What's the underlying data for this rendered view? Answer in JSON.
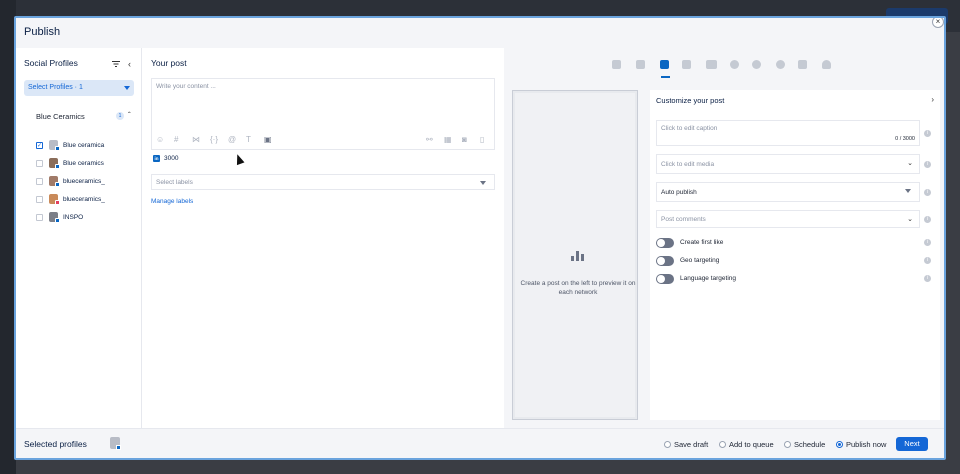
{
  "modal": {
    "title": "Publish",
    "close_glyph": "×"
  },
  "left": {
    "title": "Social Profiles",
    "select_label": "Select Profiles · 1",
    "group": {
      "name": "Blue Ceramics",
      "count": "1"
    },
    "profiles": [
      {
        "name": "Blue ceramica",
        "checked": true,
        "network": "linkedin"
      },
      {
        "name": "Blue ceramics",
        "checked": false,
        "network": "linkedin"
      },
      {
        "name": "blueceramics_",
        "checked": false,
        "network": "linkedin"
      },
      {
        "name": "blueceramics_",
        "checked": false,
        "network": "instagram"
      },
      {
        "name": "INSPO",
        "checked": false,
        "network": "linkedin"
      }
    ]
  },
  "middle": {
    "title": "Your post",
    "placeholder": "Write your content ...",
    "counter": "3000",
    "labels_placeholder": "Select labels",
    "manage_labels": "Manage labels"
  },
  "right": {
    "networks": [
      "facebook-icon",
      "instagram-icon",
      "linkedin-icon",
      "twitter-icon",
      "youtube-icon",
      "google-icon",
      "pinterest-icon",
      "tiktok-icon",
      "snapchat-icon"
    ],
    "active_network": "linkedin-icon",
    "preview_text": "Create a post on the left to preview it on each network",
    "customize": {
      "title": "Customize your post",
      "caption_placeholder": "Click to edit caption",
      "caption_count": "0 / 3000",
      "media_placeholder": "Click to edit media",
      "publish_mode": "Auto publish",
      "comments_placeholder": "Post comments",
      "toggles": [
        "Create first like",
        "Geo targeting",
        "Language targeting"
      ]
    }
  },
  "footer": {
    "selected_profiles": "Selected profiles",
    "options": [
      "Save draft",
      "Add to queue",
      "Schedule",
      "Publish now"
    ],
    "selected_option": "Publish now",
    "next": "Next"
  },
  "colors": {
    "accent": "#1467d6",
    "linkedin": "#0a66c2",
    "panel_bg": "#f4f5f8"
  }
}
